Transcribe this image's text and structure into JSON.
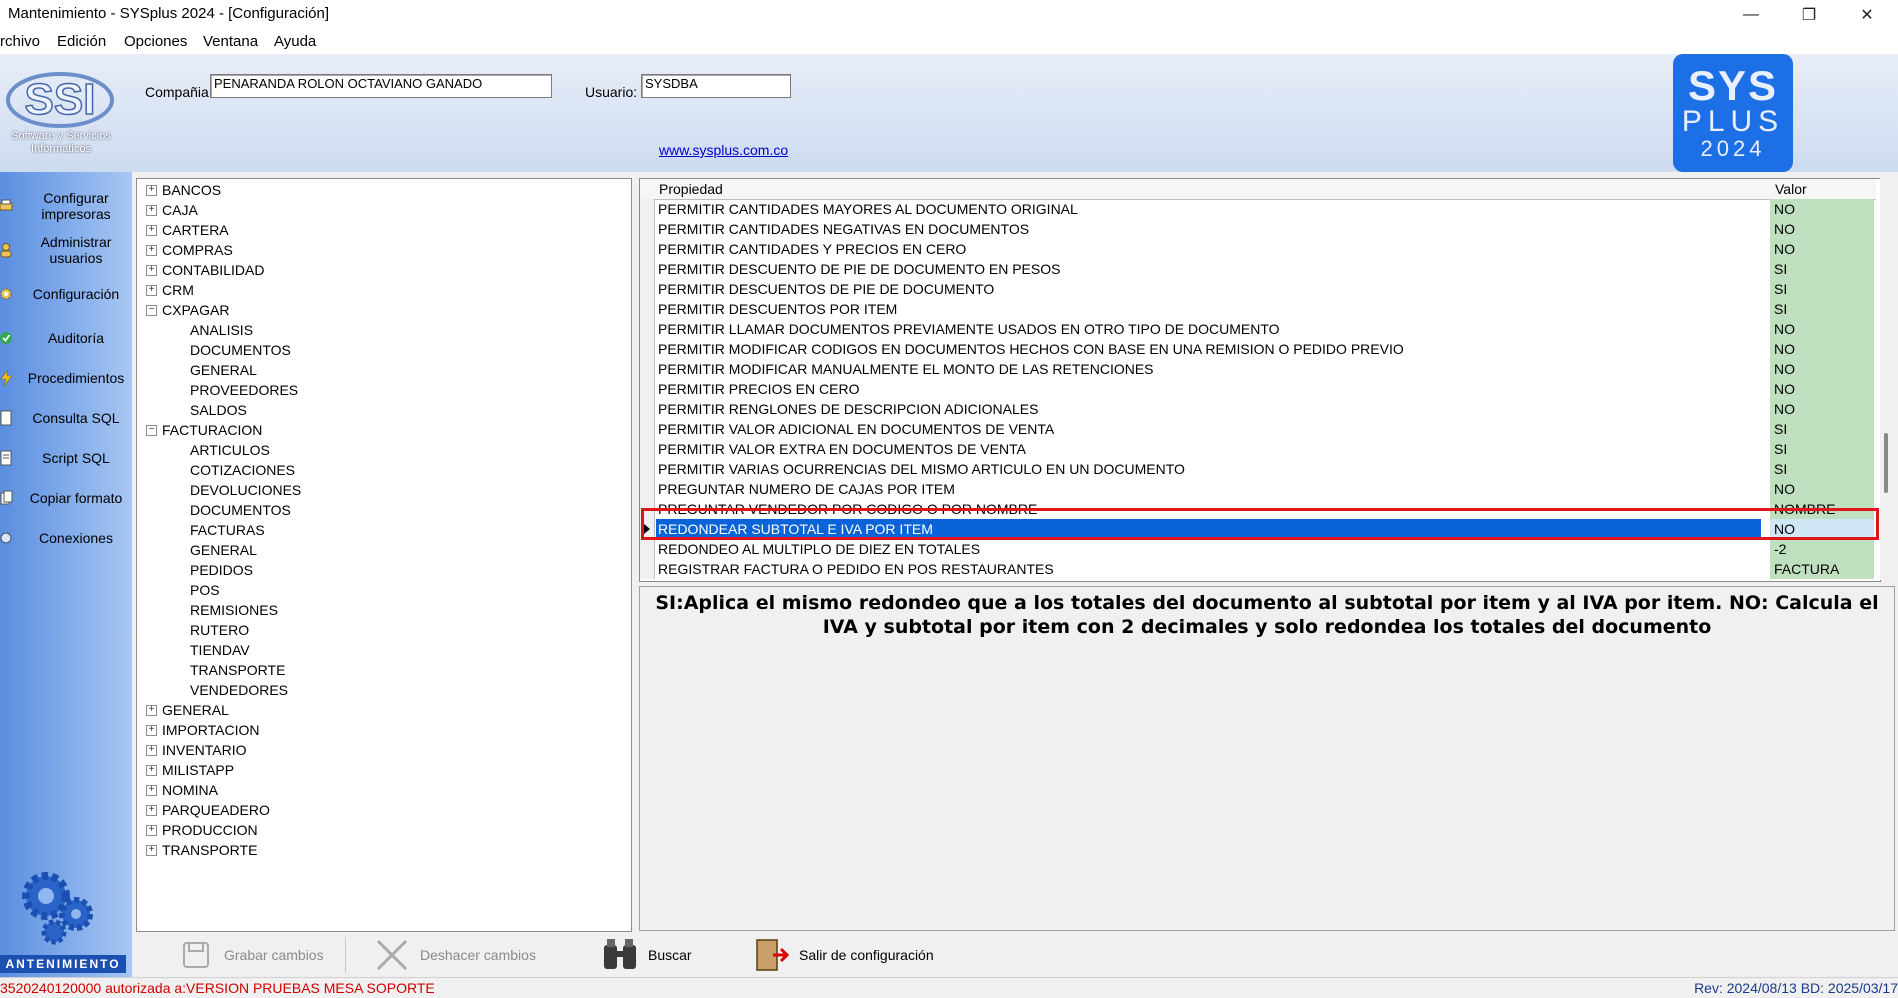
{
  "window": {
    "title": "Mantenimiento - SYSplus 2024 - [Configuración]",
    "minimize_glyph": "—",
    "restore_glyph": "❐",
    "close_glyph": "✕"
  },
  "menu": [
    "rchivo",
    "Edición",
    "Opciones",
    "Ventana",
    "Ayuda"
  ],
  "header": {
    "company_label": "Compañia:",
    "company_value": "PENARANDA ROLON OCTAVIANO GANADO",
    "user_label": "Usuario:",
    "user_value": "SYSDBA",
    "website": "www.sysplus.com.co",
    "logo_text": "SSI",
    "logo_caption": "Software y Servicios Informaticos",
    "sys_logo": {
      "line1": "SYS",
      "line2": "PLUS",
      "line3": "2024"
    }
  },
  "sidebar": {
    "items": [
      {
        "label": "Configurar impresoras",
        "icon": "printer-icon"
      },
      {
        "label": "Administrar usuarios",
        "icon": "users-icon"
      },
      {
        "label": "Configuración",
        "icon": "gear-icon"
      },
      {
        "label": "Auditoría",
        "icon": "check-icon"
      },
      {
        "label": "Procedimientos",
        "icon": "lightning-icon"
      },
      {
        "label": "Consulta SQL",
        "icon": "document-icon"
      },
      {
        "label": "Script SQL",
        "icon": "script-icon"
      },
      {
        "label": "Copiar formato",
        "icon": "copy-icon"
      },
      {
        "label": "Conexiones",
        "icon": "connection-icon"
      }
    ],
    "footer_label": "ANTENIMIENTO"
  },
  "tree": [
    {
      "label": "BANCOS",
      "level": 0,
      "expander": "+"
    },
    {
      "label": "CAJA",
      "level": 0,
      "expander": "+"
    },
    {
      "label": "CARTERA",
      "level": 0,
      "expander": "+"
    },
    {
      "label": "COMPRAS",
      "level": 0,
      "expander": "+"
    },
    {
      "label": "CONTABILIDAD",
      "level": 0,
      "expander": "+"
    },
    {
      "label": "CRM",
      "level": 0,
      "expander": "+"
    },
    {
      "label": "CXPAGAR",
      "level": 0,
      "expander": "−"
    },
    {
      "label": "ANALISIS",
      "level": 1
    },
    {
      "label": "DOCUMENTOS",
      "level": 1
    },
    {
      "label": "GENERAL",
      "level": 1
    },
    {
      "label": "PROVEEDORES",
      "level": 1
    },
    {
      "label": "SALDOS",
      "level": 1
    },
    {
      "label": "FACTURACION",
      "level": 0,
      "expander": "−"
    },
    {
      "label": "ARTICULOS",
      "level": 1
    },
    {
      "label": "COTIZACIONES",
      "level": 1
    },
    {
      "label": "DEVOLUCIONES",
      "level": 1
    },
    {
      "label": "DOCUMENTOS",
      "level": 1
    },
    {
      "label": "FACTURAS",
      "level": 1
    },
    {
      "label": "GENERAL",
      "level": 1
    },
    {
      "label": "PEDIDOS",
      "level": 1
    },
    {
      "label": "POS",
      "level": 1
    },
    {
      "label": "REMISIONES",
      "level": 1
    },
    {
      "label": "RUTERO",
      "level": 1
    },
    {
      "label": "TIENDAV",
      "level": 1
    },
    {
      "label": "TRANSPORTE",
      "level": 1
    },
    {
      "label": "VENDEDORES",
      "level": 1
    },
    {
      "label": "GENERAL",
      "level": 0,
      "expander": "+"
    },
    {
      "label": "IMPORTACION",
      "level": 0,
      "expander": "+"
    },
    {
      "label": "INVENTARIO",
      "level": 0,
      "expander": "+"
    },
    {
      "label": "MILISTAPP",
      "level": 0,
      "expander": "+"
    },
    {
      "label": "NOMINA",
      "level": 0,
      "expander": "+"
    },
    {
      "label": "PARQUEADERO",
      "level": 0,
      "expander": "+"
    },
    {
      "label": "PRODUCCION",
      "level": 0,
      "expander": "+"
    },
    {
      "label": "TRANSPORTE",
      "level": 0,
      "expander": "+"
    }
  ],
  "grid": {
    "col_property": "Propiedad",
    "col_value": "Valor",
    "rows": [
      {
        "prop": "PERMITIR CANTIDADES MAYORES AL DOCUMENTO ORIGINAL",
        "val": "NO"
      },
      {
        "prop": "PERMITIR CANTIDADES NEGATIVAS EN DOCUMENTOS",
        "val": "NO"
      },
      {
        "prop": "PERMITIR CANTIDADES Y PRECIOS EN CERO",
        "val": "NO"
      },
      {
        "prop": "PERMITIR DESCUENTO DE PIE DE DOCUMENTO EN PESOS",
        "val": "SI"
      },
      {
        "prop": "PERMITIR DESCUENTOS DE PIE DE DOCUMENTO",
        "val": "SI"
      },
      {
        "prop": "PERMITIR DESCUENTOS POR ITEM",
        "val": "SI"
      },
      {
        "prop": "PERMITIR LLAMAR DOCUMENTOS PREVIAMENTE USADOS EN OTRO TIPO DE DOCUMENTO",
        "val": "NO"
      },
      {
        "prop": "PERMITIR MODIFICAR CODIGOS EN DOCUMENTOS HECHOS CON BASE EN UNA REMISION O PEDIDO PREVIO",
        "val": "NO"
      },
      {
        "prop": "PERMITIR MODIFICAR MANUALMENTE EL MONTO DE LAS RETENCIONES",
        "val": "NO"
      },
      {
        "prop": "PERMITIR PRECIOS EN CERO",
        "val": "NO"
      },
      {
        "prop": "PERMITIR RENGLONES DE DESCRIPCION ADICIONALES",
        "val": "NO"
      },
      {
        "prop": "PERMITIR VALOR ADICIONAL EN DOCUMENTOS DE VENTA",
        "val": "SI"
      },
      {
        "prop": "PERMITIR VALOR EXTRA EN DOCUMENTOS DE VENTA",
        "val": "SI"
      },
      {
        "prop": "PERMITIR VARIAS OCURRENCIAS DEL MISMO ARTICULO EN UN DOCUMENTO",
        "val": "SI"
      },
      {
        "prop": "PREGUNTAR NUMERO DE CAJAS POR ITEM",
        "val": "NO"
      },
      {
        "prop": "PREGUNTAR VENDEDOR POR CODIGO O POR NOMBRE",
        "val": "NOMBRE"
      },
      {
        "prop": "REDONDEAR SUBTOTAL E IVA POR ITEM",
        "val": "NO",
        "selected": true
      },
      {
        "prop": "REDONDEO AL MULTIPLO DE DIEZ EN TOTALES",
        "val": "-2"
      },
      {
        "prop": "REGISTRAR FACTURA O PEDIDO EN POS RESTAURANTES",
        "val": "FACTURA"
      }
    ]
  },
  "description": "SI:Aplica el mismo redondeo que a los totales del documento al subtotal por item y al IVA por item. NO: Calcula el IVA y subtotal por item con 2 decimales y solo redondea los totales del documento",
  "toolbar": {
    "save": "Grabar cambios",
    "undo": "Deshacer cambios",
    "search": "Buscar",
    "exit": "Salir de configuración"
  },
  "status": {
    "left": "3520240120000 autorizada a:VERSION PRUEBAS MESA SOPORTE",
    "right": "Rev: 2024/08/13 BD: 2025/03/17"
  },
  "colors": {
    "accent": "#0a64d8",
    "highlight_border": "#e0141b",
    "value_bg": "#bfe0bf",
    "status_red": "#d00000"
  }
}
